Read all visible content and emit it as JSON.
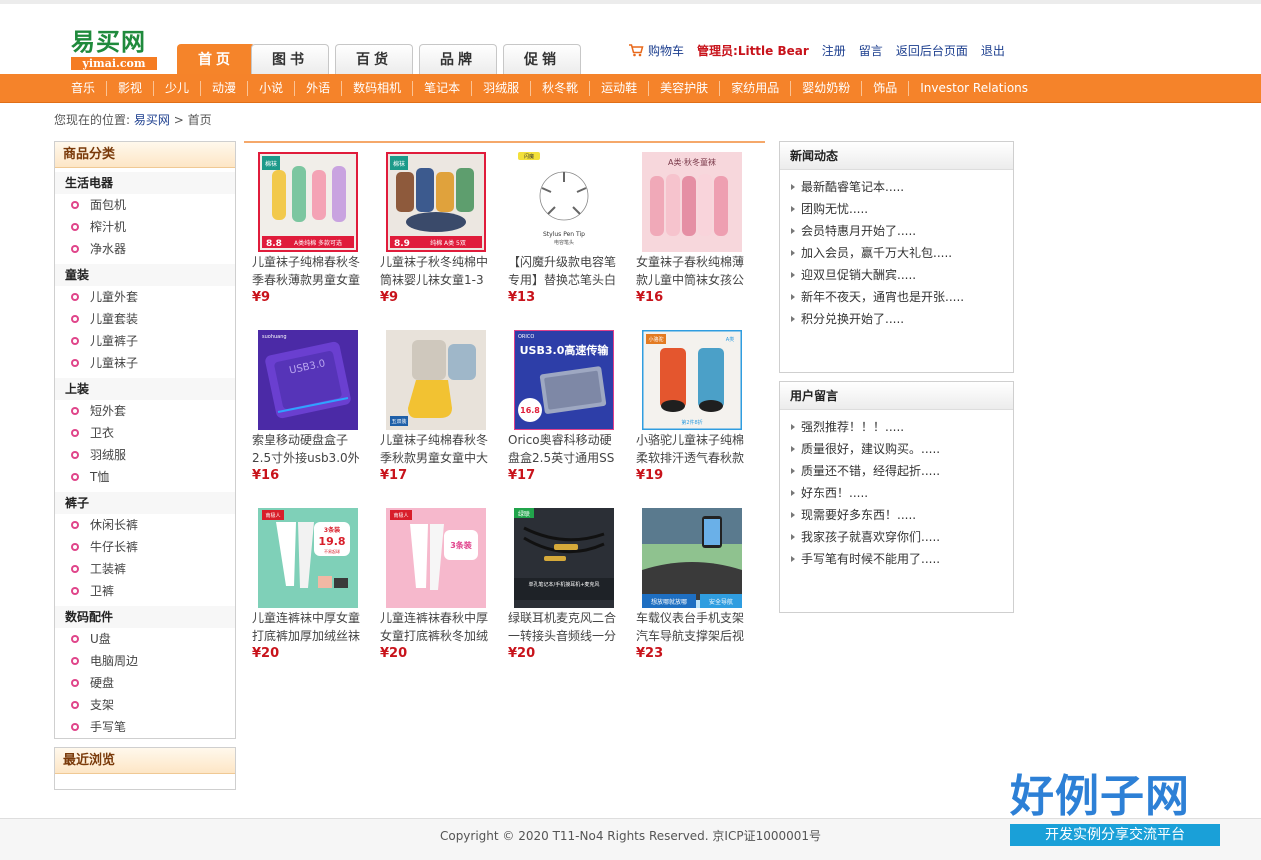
{
  "logo": {
    "cn": "易买网",
    "en": "yimai.com"
  },
  "tabs": [
    "首页",
    "图书",
    "百货",
    "品牌",
    "促销"
  ],
  "toplinks": {
    "cart": "购物车",
    "admin": "管理员:Little Bear",
    "register": "注册",
    "message": "留言",
    "backend": "返回后台页面",
    "logout": "退出"
  },
  "nav": [
    "音乐",
    "影视",
    "少儿",
    "动漫",
    "小说",
    "外语",
    "数码相机",
    "笔记本",
    "羽绒服",
    "秋冬靴",
    "运动鞋",
    "美容护肤",
    "家纺用品",
    "婴幼奶粉",
    "饰品",
    "Investor Relations"
  ],
  "breadcrumb": {
    "prefix": "您现在的位置:",
    "home": "易买网",
    "sep": ">",
    "current": "首页"
  },
  "sidebar": {
    "title": "商品分类",
    "groups": [
      {
        "title": "生活电器",
        "items": [
          "面包机",
          "榨汁机",
          "净水器"
        ]
      },
      {
        "title": "童装",
        "items": [
          "儿童外套",
          "儿童套装",
          "儿童裤子",
          "儿童袜子"
        ]
      },
      {
        "title": "上装",
        "items": [
          "短外套",
          "卫衣",
          "羽绒服",
          "T恤"
        ]
      },
      {
        "title": "裤子",
        "items": [
          "休闲长裤",
          "牛仔长裤",
          "工装裤",
          "卫裤"
        ]
      },
      {
        "title": "数码配件",
        "items": [
          "U盘",
          "电脑周边",
          "硬盘",
          "支架",
          "手写笔"
        ]
      }
    ],
    "recent_title": "最近浏览"
  },
  "products": [
    {
      "name": "儿童袜子纯棉春秋冬季春秋薄款男童女童",
      "price": "¥9"
    },
    {
      "name": "儿童袜子秋冬纯棉中筒袜婴儿袜女童1-3",
      "price": "¥9"
    },
    {
      "name": "【闪魔升级款电容笔专用】替换芯笔头白",
      "price": "¥13"
    },
    {
      "name": "女童袜子春秋纯棉薄款儿童中筒袜女孩公",
      "price": "¥16"
    },
    {
      "name": "索皇移动硬盘盒子2.5寸外接usb3.0外置",
      "price": "¥16"
    },
    {
      "name": "儿童袜子纯棉春秋冬季秋款男童女童中大",
      "price": "¥17"
    },
    {
      "name": "Orico奥睿科移动硬盘盒2.5英寸通用SS",
      "price": "¥17"
    },
    {
      "name": "小骆驼儿童袜子纯棉柔软排汗透气春秋款",
      "price": "¥19"
    },
    {
      "name": "儿童连裤袜中厚女童打底裤加厚加绒丝袜",
      "price": "¥20"
    },
    {
      "name": "儿童连裤袜春秋中厚女童打底裤秋冬加绒",
      "price": "¥20"
    },
    {
      "name": "绿联耳机麦克风二合一转接头音频线一分",
      "price": "¥20"
    },
    {
      "name": "车载仪表台手机支架汽车导航支撑架后视",
      "price": "¥23"
    }
  ],
  "product_images": {
    "p1": {
      "tag": "棉袜",
      "badge": "8.8",
      "bar": "A类纯棉 多款可选"
    },
    "p2": {
      "tag": "棉袜",
      "badge": "8.9",
      "bar": "纯棉 A类 5双"
    },
    "p3": {
      "tag": "闪魔",
      "caption": "Stylus Pen Tip",
      "caption2": "电容笔头"
    },
    "p4": {
      "title": "A类·秋冬童袜"
    },
    "p5": {
      "brand": "suohuang",
      "text": "USB3.0"
    },
    "p6": {
      "tag": "五双装"
    },
    "p7": {
      "brand": "ORICO",
      "title": "USB3.0高速传输",
      "badge": "16.8"
    },
    "p8": {
      "brand": "小骆驼",
      "tag": "A类",
      "promo": "第2件8折"
    },
    "p9": {
      "tag": "南极人",
      "badge1": "3条装",
      "badge2": "19.8",
      "badge3": "不易起球"
    },
    "p10": {
      "tag": "南极人",
      "badge": "3条装"
    },
    "p11": {
      "brand": "绿联",
      "text": "单孔笔记本/手机接耳机+麦克风"
    },
    "p12": {
      "bar1": "想放哪就放哪",
      "bar2": "安全导航"
    }
  },
  "news": {
    "title": "新闻动态",
    "items": [
      "最新酷睿笔记本.....",
      "团购无忧.....",
      "会员特惠月开始了.....",
      "加入会员，赢千万大礼包.....",
      "迎双旦促销大酬宾.....",
      "新年不夜天，通宵也是开张.....",
      "积分兑换开始了....."
    ]
  },
  "messages": {
    "title": "用户留言",
    "items": [
      "强烈推荐！！！.....",
      "质量很好，建议购买。.....",
      "质量还不错，经得起折.....",
      "好东西！.....",
      "现需要好多东西！.....",
      "我家孩子就喜欢穿你们.....",
      "手写笔有时候不能用了....."
    ]
  },
  "footer": "Copyright © 2020 T11-No4 Rights Reserved. 京ICP证1000001号",
  "watermark": {
    "big": "好例子网",
    "small": "开发实例分享交流平台"
  },
  "colors": {
    "accent": "#f5832a",
    "link": "#1d3f8f",
    "price": "#c8131b",
    "logo_green": "#1f8a3c"
  }
}
